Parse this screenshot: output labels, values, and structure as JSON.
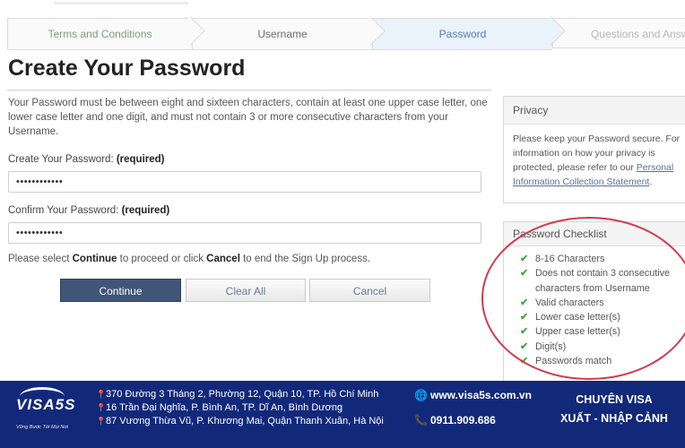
{
  "stepper": {
    "steps": [
      "Terms and Conditions",
      "Username",
      "Password",
      "Questions and Answers"
    ]
  },
  "form": {
    "title": "Create Your Password",
    "intro": "Your Password must be between eight and sixteen characters, contain at least one upper case letter, one lower case letter and one digit, and must not contain 3 or more consecutive characters from your Username.",
    "password_label": "Create Your Password:",
    "confirm_label": "Confirm Your Password:",
    "required_tag": "(required)",
    "password_value": "••••••••••••",
    "confirm_value": "••••••••••••",
    "note_prefix": "Please select",
    "note_continue": "Continue",
    "note_middle": "to proceed or click",
    "note_cancel": "Cancel",
    "note_suffix": "to end the Sign Up process.",
    "continue_label": "Continue",
    "clear_label": "Clear All",
    "cancel_label": "Cancel"
  },
  "privacy": {
    "title": "Privacy",
    "text": "Please keep your Password secure. For information on how your privacy is protected, please refer to our",
    "link": "Personal Information Collection Statement",
    "end": "."
  },
  "checklist": {
    "title": "Password Checklist",
    "items": [
      "8-16 Characters",
      "Does not contain 3 consecutive characters from Username",
      "Valid characters",
      "Lower case letter(s)",
      "Upper case letter(s)",
      "Digit(s)",
      "Passwords match"
    ]
  },
  "footer": {
    "logo": "VISA5S",
    "tagline": "Vững Bước Tới Mọi Nơi",
    "addresses": [
      "370 Đường 3 Tháng 2, Phường 12, Quận 10, TP. Hồ Chí Minh",
      "16 Trần Đại Nghĩa, P. Bình An, TP. Dĩ An, Bình Dương",
      "87 Vương Thừa Vũ, P. Khương Mai, Quận Thanh Xuân, Hà Nội"
    ],
    "website": "www.visa5s.com.vn",
    "phone": "0911.909.686",
    "slogan_line1": "CHUYÊN VISA",
    "slogan_line2": "XUẤT - NHẬP CẢNH"
  },
  "colors": {
    "primary_button": "#3f5678",
    "footer_bg": "#12297a",
    "annotation_oval": "#d23b4d",
    "check": "#49a24c"
  }
}
